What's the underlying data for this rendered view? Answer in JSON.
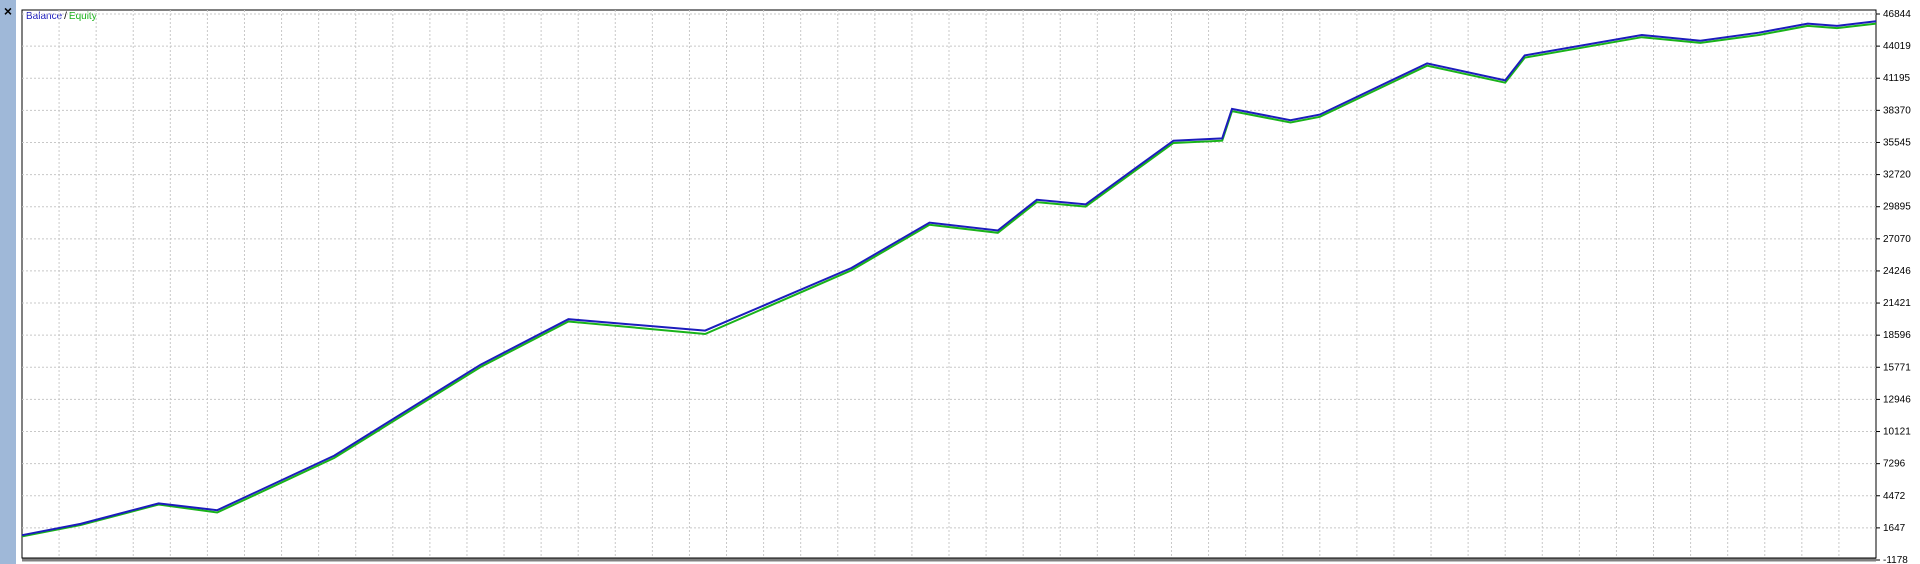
{
  "toolbar": {
    "close_label": "×"
  },
  "legend": {
    "balance_label": "Balance",
    "separator": "/",
    "equity_label": "Equity"
  },
  "colors": {
    "balance": "#1c1cbd",
    "equity": "#19b319",
    "grid": "#c8c8c8",
    "sidebar": "#9fb8d8"
  },
  "chart_data": {
    "type": "line",
    "title": "",
    "xlabel": "",
    "ylabel": "",
    "ylim": [
      -1178,
      46844
    ],
    "yticks": [
      46844,
      44019,
      41195,
      38370,
      35545,
      32720,
      29895,
      27070,
      24246,
      21421,
      18596,
      15771,
      12946,
      10121,
      7296,
      4472,
      1647,
      -1178
    ],
    "grid": true,
    "legend": "top-left",
    "series": [
      {
        "name": "Balance",
        "color": "#1c1cbd",
        "x": [
          0,
          60,
          140,
          200,
          320,
          470,
          560,
          700,
          850,
          930,
          1000,
          1040,
          1090,
          1180,
          1230,
          1240,
          1300,
          1330,
          1440,
          1520,
          1540,
          1660,
          1720,
          1780,
          1830,
          1860,
          1900
        ],
        "y": [
          1000,
          2000,
          3800,
          3200,
          8000,
          16000,
          20000,
          19000,
          24500,
          28500,
          27800,
          30500,
          30100,
          35700,
          35900,
          38500,
          37500,
          38000,
          42500,
          41000,
          43200,
          45000,
          44500,
          45200,
          46000,
          45800,
          46200
        ]
      },
      {
        "name": "Equity",
        "color": "#19b319",
        "x": [
          0,
          60,
          140,
          200,
          320,
          470,
          560,
          700,
          850,
          930,
          1000,
          1040,
          1090,
          1180,
          1230,
          1240,
          1300,
          1330,
          1440,
          1520,
          1540,
          1660,
          1720,
          1780,
          1830,
          1860,
          1900
        ],
        "y": [
          900,
          1900,
          3700,
          3000,
          7800,
          15800,
          19800,
          18700,
          24300,
          28300,
          27600,
          30300,
          29900,
          35500,
          35700,
          38300,
          37300,
          37800,
          42300,
          40800,
          43000,
          44800,
          44300,
          45000,
          45800,
          45600,
          46000
        ]
      }
    ]
  }
}
